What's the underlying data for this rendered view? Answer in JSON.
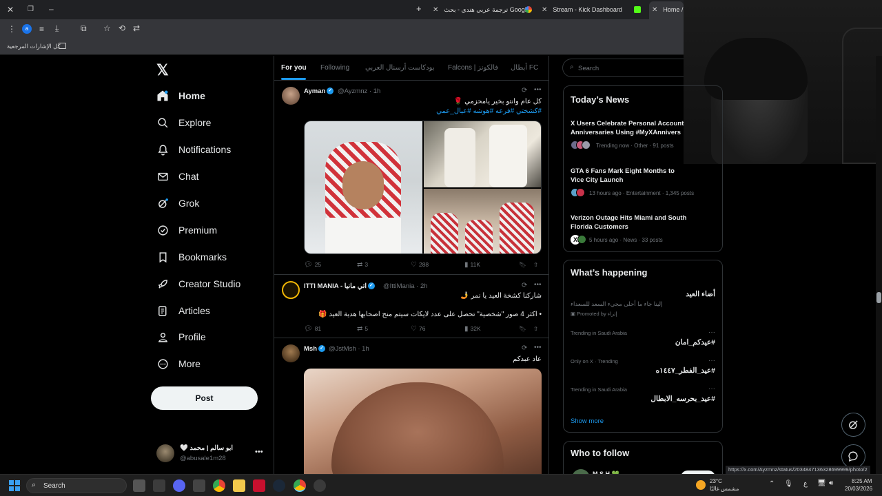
{
  "browser": {
    "tabs": [
      {
        "title": "Home / X"
      },
      {
        "title": "Stream - Kick Dashboard"
      },
      {
        "title": "ترجمة عربي هندي - بحث Google"
      }
    ],
    "bookmarks_label": "كل الإشارات المرجعية",
    "status_url": "https://x.com/Ayzmnz/status/2034847136328699999/photo/2"
  },
  "nav": {
    "items": [
      {
        "label": "Home"
      },
      {
        "label": "Explore"
      },
      {
        "label": "Notifications"
      },
      {
        "label": "Chat"
      },
      {
        "label": "Grok"
      },
      {
        "label": "Premium"
      },
      {
        "label": "Bookmarks"
      },
      {
        "label": "Creator Studio"
      },
      {
        "label": "Articles"
      },
      {
        "label": "Profile"
      },
      {
        "label": "More"
      }
    ],
    "post_button": "Post",
    "account": {
      "name": "ابو سالم | محمد 🤍",
      "handle": "@abusale1m28"
    }
  },
  "feed": {
    "tabs": [
      "For you",
      "Following",
      "بودكاست أرسنال العربي",
      "Falcons | فالكونز",
      "أبطال FC"
    ],
    "tweets": [
      {
        "name": "Ayman",
        "handle": "@Ayzmnz · 1h",
        "text": "كل عام وانتو بخير يامحزمي 🌹",
        "tags": "#كشختي #فرعه #هوشه #عيال_عمي",
        "stats": {
          "replies": "25",
          "reposts": "3",
          "likes": "288",
          "views": "11K"
        }
      },
      {
        "name": "ITTI MANIA - اتي مانيا",
        "handle": "@IttiMania · 2h",
        "text": "شاركنا كشخة العيد يا نمر 🤳",
        "text2": "• اكثر 4 صور \"شخصية\" تحصل على عدد لايكات سيتم منح اصحابها هدية العيد 🎁",
        "stats": {
          "replies": "81",
          "reposts": "5",
          "likes": "76",
          "views": "32K"
        }
      },
      {
        "name": "Msh",
        "handle": "@JstMsh · 1h",
        "text": "عاد عبدكم"
      }
    ]
  },
  "right": {
    "search_placeholder": "Search",
    "news_title": "Today’s News",
    "news": [
      {
        "headline": "X Users Celebrate Personal Account Anniversaries Using #MyXAnnivers",
        "meta": "Trending now · Other · 91 posts"
      },
      {
        "headline": "GTA 6 Fans Mark Eight Months to Vice City Launch",
        "meta": "13 hours ago · Entertainment · 1,345 posts"
      },
      {
        "headline": "Verizon Outage Hits Miami and South Florida Customers",
        "meta": "5 hours ago · News · 33 posts"
      }
    ],
    "happening_title": "What’s happening",
    "promo": {
      "title": "أضاء العيد",
      "desc": "إلينا جاء ما أحلى مجيء السعد للسعداء",
      "promoted": "Promoted by إثراء"
    },
    "trends": [
      {
        "context": "Trending in Saudi Arabia",
        "name": "#عيدكم_امان"
      },
      {
        "context": "Only on X · Trending",
        "name": "#عيد_الفطر_١٤٤٧ه"
      },
      {
        "context": "Trending in Saudi Arabia",
        "name": "#عيد_بحرسه_الابطال"
      }
    ],
    "show_more": "Show more",
    "who_to_follow": "Who to follow",
    "follow_name": "M S H 💚"
  },
  "taskbar": {
    "search": "Search",
    "weather_temp": "23°C",
    "weather_desc": "مشمس غالبًا",
    "time": "8:25 AM",
    "date": "20/03/2026",
    "lang": "ع"
  },
  "colors": {
    "accent": "#1d9bf0",
    "bg": "#000000",
    "border": "#2f3336",
    "muted": "#71767b"
  }
}
